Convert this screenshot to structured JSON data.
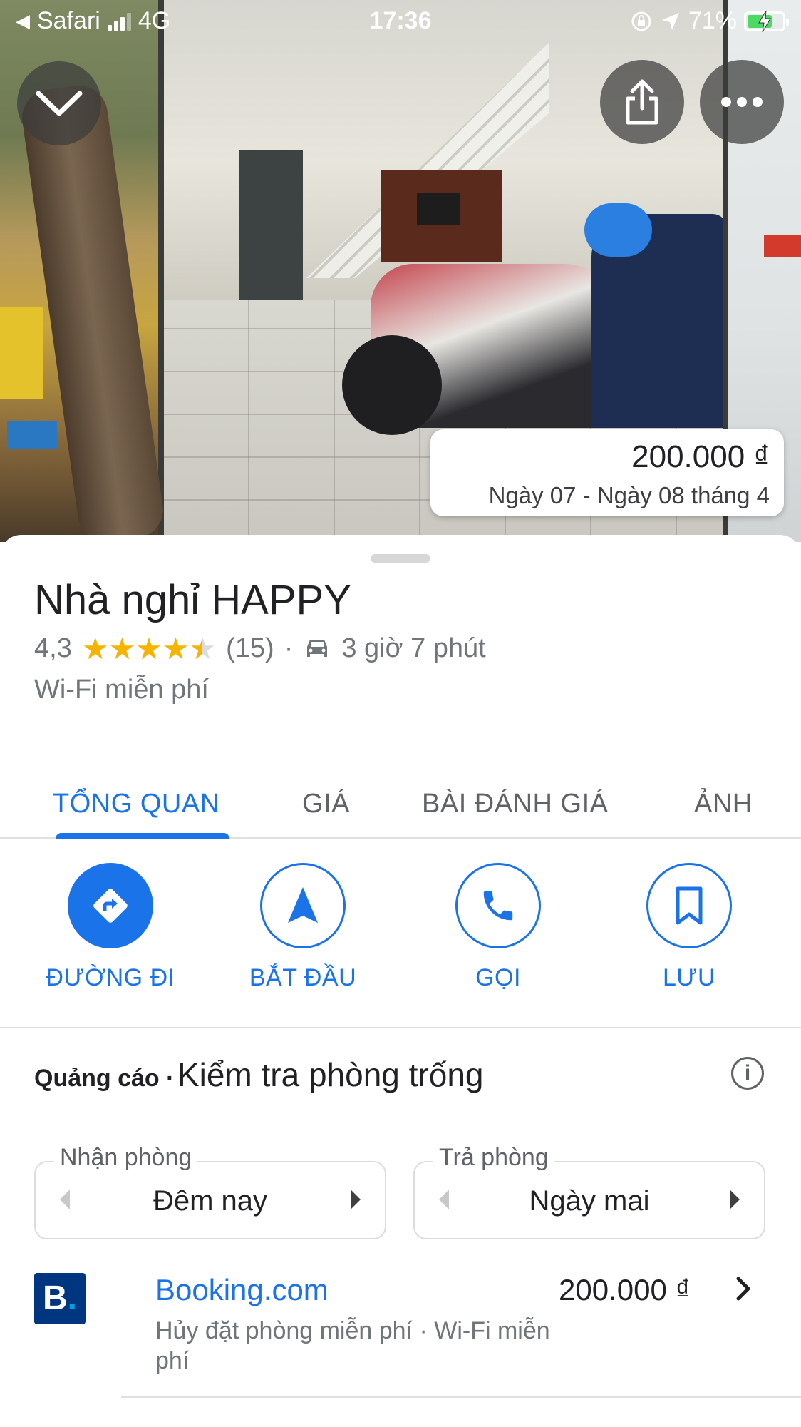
{
  "status_bar": {
    "back_app": "Safari",
    "network": "4G",
    "time": "17:36",
    "battery": "71%"
  },
  "photo": {
    "price": "200.000 ₫",
    "dates": "Ngày 07 - Ngày 08 tháng 4"
  },
  "place": {
    "name": "Nhà nghỉ HAPPY",
    "rating": "4,3",
    "rating_value": 4.3,
    "review_count": "(15)",
    "separator": "·",
    "drive_time": "3 giờ 7 phút",
    "amenity": "Wi-Fi miễn phí"
  },
  "tabs": [
    {
      "label": "TỔNG QUAN",
      "active": true
    },
    {
      "label": "GIÁ",
      "active": false
    },
    {
      "label": "BÀI ĐÁNH GIÁ",
      "active": false
    },
    {
      "label": "ẢNH",
      "active": false
    }
  ],
  "actions": [
    {
      "label": "ĐƯỜNG ĐI",
      "icon": "directions-icon"
    },
    {
      "label": "BẮT ĐẦU",
      "icon": "navigation-arrow-icon"
    },
    {
      "label": "GỌI",
      "icon": "phone-icon"
    },
    {
      "label": "LƯU",
      "icon": "bookmark-icon"
    }
  ],
  "availability": {
    "ad_label": "Quảng cáo ·",
    "heading": "Kiểm tra phòng trống",
    "check_in": {
      "legend": "Nhận phòng",
      "value": "Đêm nay"
    },
    "check_out": {
      "legend": "Trả phòng",
      "value": "Ngày mai"
    }
  },
  "provider": {
    "logo_letter": "B",
    "logo_dot": ".",
    "name": "Booking.com",
    "price": "200.000 ₫",
    "description": "Hủy đặt phòng miễn phí · Wi-Fi miễn phí"
  },
  "colors": {
    "accent": "#1a73e8",
    "star": "#f4b400",
    "booking_brand": "#003580"
  }
}
